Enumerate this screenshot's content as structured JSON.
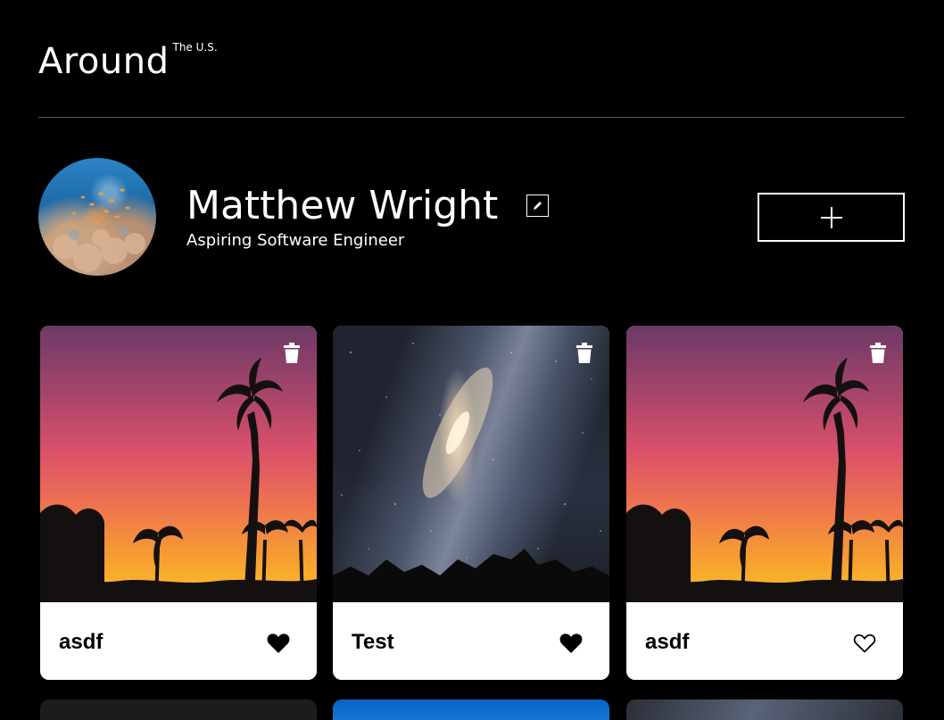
{
  "header": {
    "logo_main": "Around",
    "logo_sup": "The U.S."
  },
  "profile": {
    "name": "Matthew Wright",
    "job": "Aspiring Software Engineer",
    "edit_icon": "pencil-icon",
    "add_icon": "plus-icon"
  },
  "cards": [
    {
      "title": "asdf",
      "image": "sunset-palms",
      "liked": true
    },
    {
      "title": "Test",
      "image": "milky-way-galaxy",
      "liked": true
    },
    {
      "title": "asdf",
      "image": "sunset-palms",
      "liked": false
    }
  ],
  "colors": {
    "background": "#000000",
    "card_footer": "#ffffff",
    "divider": "#545454"
  }
}
